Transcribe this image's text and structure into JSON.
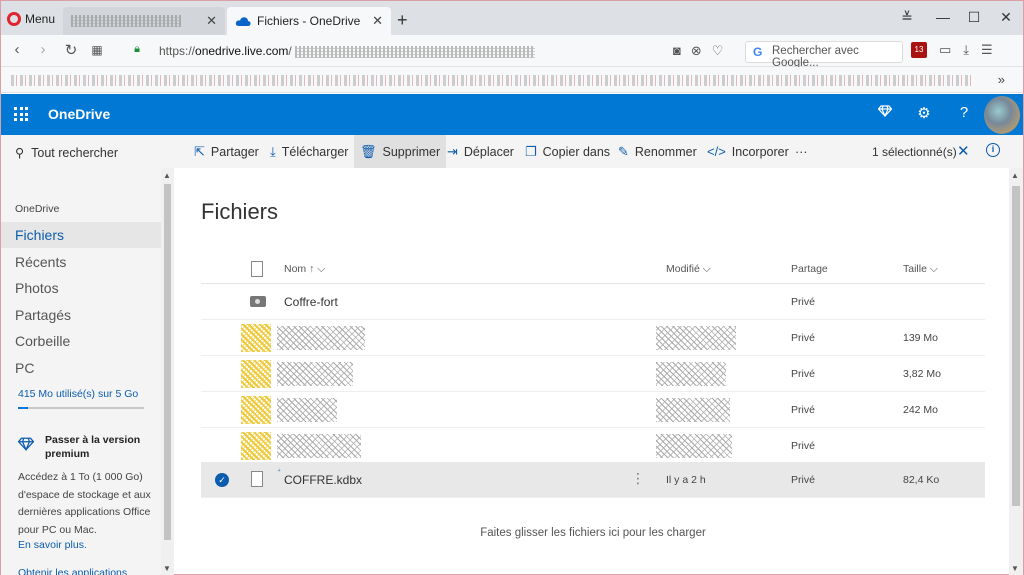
{
  "browser": {
    "menu_label": "Menu",
    "active_tab_title": "Fichiers - OneDrive",
    "url_prefix": "https://",
    "url_domain": "onedrive.live.com",
    "url_suffix": "/",
    "search_placeholder": "Rechercher avec Google...",
    "extension_badge": "13"
  },
  "header": {
    "app_name": "OneDrive"
  },
  "sidebar": {
    "search_label": "Tout rechercher",
    "section_label": "OneDrive",
    "items": [
      {
        "label": "Fichiers",
        "selected": true
      },
      {
        "label": "Récents"
      },
      {
        "label": "Photos"
      },
      {
        "label": "Partagés"
      },
      {
        "label": "Corbeille"
      },
      {
        "label": "PC"
      }
    ],
    "quota_text": "415 Mo utilisé(s) sur 5 Go",
    "quota_fraction": 0.083,
    "premium_title": "Passer à la version premium",
    "premium_text": "Accédez à 1 To (1 000 Go) d'espace de stockage et aux dernières applications Office pour PC ou Mac.",
    "learn_more": "En savoir plus.",
    "get_apps": "Obtenir les applications"
  },
  "commandbar": {
    "share": "Partager",
    "download": "Télécharger",
    "delete": "Supprimer",
    "move": "Déplacer",
    "copy": "Copier dans",
    "rename": "Renommer",
    "embed": "Incorporer",
    "more": "···",
    "selection_count": "1 sélectionné(s)"
  },
  "main": {
    "title": "Fichiers",
    "columns": {
      "name": "Nom",
      "name_sort": "↑",
      "modified": "Modifié",
      "sharing": "Partage",
      "size": "Taille"
    },
    "rows": [
      {
        "name": "Coffre-fort",
        "modified": "",
        "sharing": "Privé",
        "size": ""
      },
      {
        "name": "",
        "modified": "",
        "sharing": "Privé",
        "size": "139 Mo"
      },
      {
        "name": "",
        "modified": "",
        "sharing": "Privé",
        "size": "3,82 Mo"
      },
      {
        "name": "",
        "modified": "",
        "sharing": "Privé",
        "size": "242 Mo"
      },
      {
        "name": "",
        "modified": "",
        "sharing": "Privé",
        "size": ""
      },
      {
        "name": "COFFRE.kdbx",
        "modified": "Il y a 2 h",
        "sharing": "Privé",
        "size": "82,4 Ko"
      }
    ],
    "drop_hint": "Faites glisser les fichiers ici pour les charger"
  }
}
